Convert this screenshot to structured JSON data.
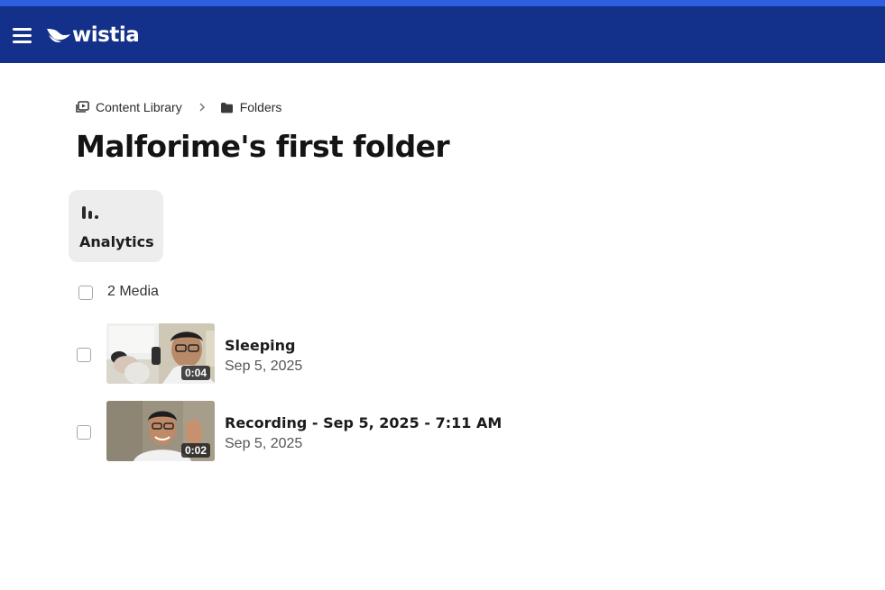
{
  "header": {
    "logo_text": "wistia",
    "colors": {
      "top_strip": "#2f5ee0",
      "bar": "#13318a"
    }
  },
  "breadcrumb": {
    "items": [
      {
        "label": "Content Library",
        "icon": "content-library-icon"
      },
      {
        "label": "Folders",
        "icon": "folder-icon"
      }
    ]
  },
  "page": {
    "title": "Malforime's first folder"
  },
  "analytics": {
    "label": "Analytics",
    "icon": "bar-chart-icon"
  },
  "media": {
    "count_label": "2 Media",
    "items": [
      {
        "title": "Sleeping",
        "date": "Sep 5, 2025",
        "duration": "0:04"
      },
      {
        "title": "Recording - Sep 5, 2025 - 7:11 AM",
        "date": "Sep 5, 2025",
        "duration": "0:02"
      }
    ]
  }
}
